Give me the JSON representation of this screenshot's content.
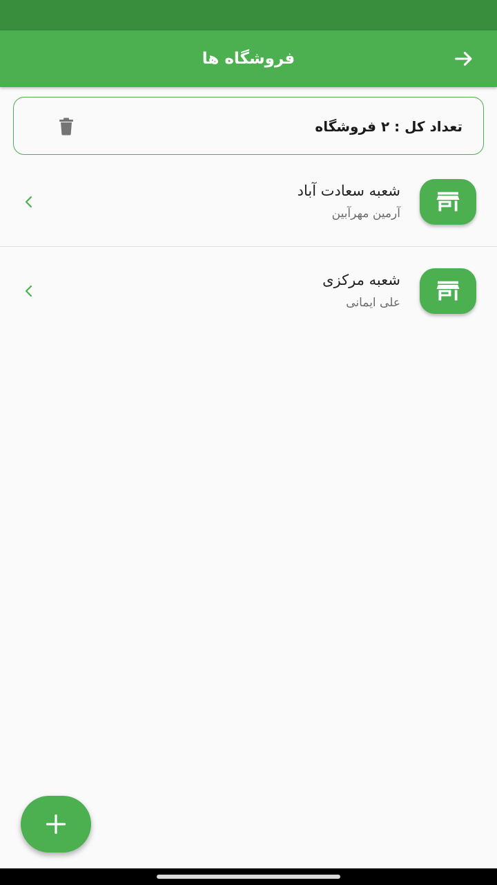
{
  "app_bar": {
    "title": "فروشگاه ها",
    "back_icon": "arrow-right-icon"
  },
  "summary": {
    "text": "تعداد کل : ۲ فروشگاه",
    "delete_icon": "trash-icon"
  },
  "stores": [
    {
      "name": "شعبه سعادت آباد",
      "manager": "آرمین مهرآبین",
      "icon": "store-icon"
    },
    {
      "name": "شعبه مرکزی",
      "manager": "علی ایمانی",
      "icon": "store-icon"
    }
  ],
  "fab": {
    "icon": "plus-icon"
  },
  "colors": {
    "primary": "#4caf50",
    "primary_dark": "#388e3c",
    "background": "#fafafa",
    "delete_icon": "#757575"
  }
}
